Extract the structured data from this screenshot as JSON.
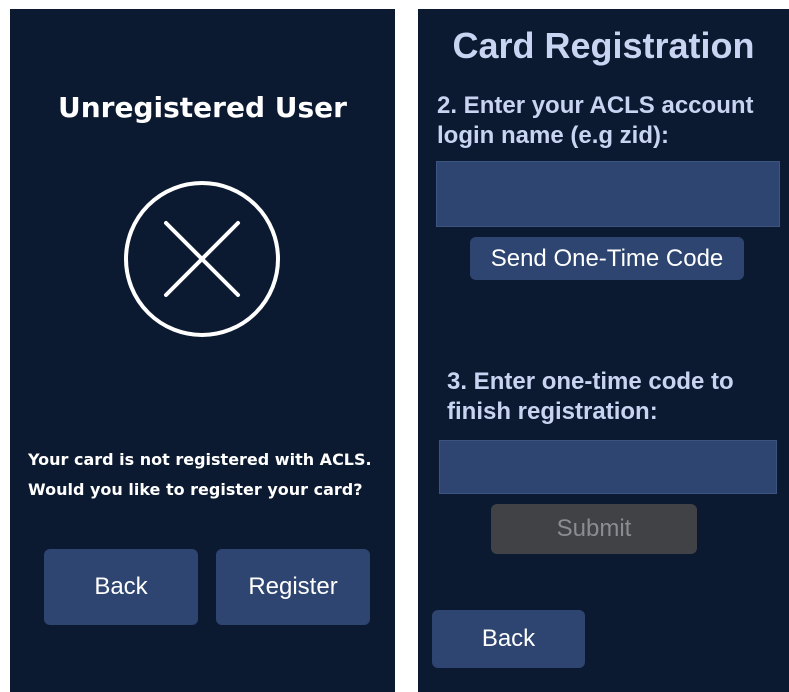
{
  "unregistered_screen": {
    "title": "Unregistered User",
    "status_icon": "x-circle-icon",
    "message_lines": [
      "Your card is not registered with ACLS.",
      "Would you like to register your card?"
    ],
    "back_label": "Back",
    "register_label": "Register"
  },
  "registration_screen": {
    "title": "Card Registration",
    "step2_label": "2. Enter your ACLS account login name (e.g zid):",
    "login_value": "",
    "send_code_label": "Send One-Time Code",
    "step3_label": "3. Enter one-time code to finish registration:",
    "code_value": "",
    "submit_label": "Submit",
    "back_label": "Back"
  },
  "colors": {
    "panel_background": "#0c1a31",
    "button_background": "#2d4570",
    "disabled_button_background": "#414246",
    "title_accent": "#c9d3f2"
  }
}
